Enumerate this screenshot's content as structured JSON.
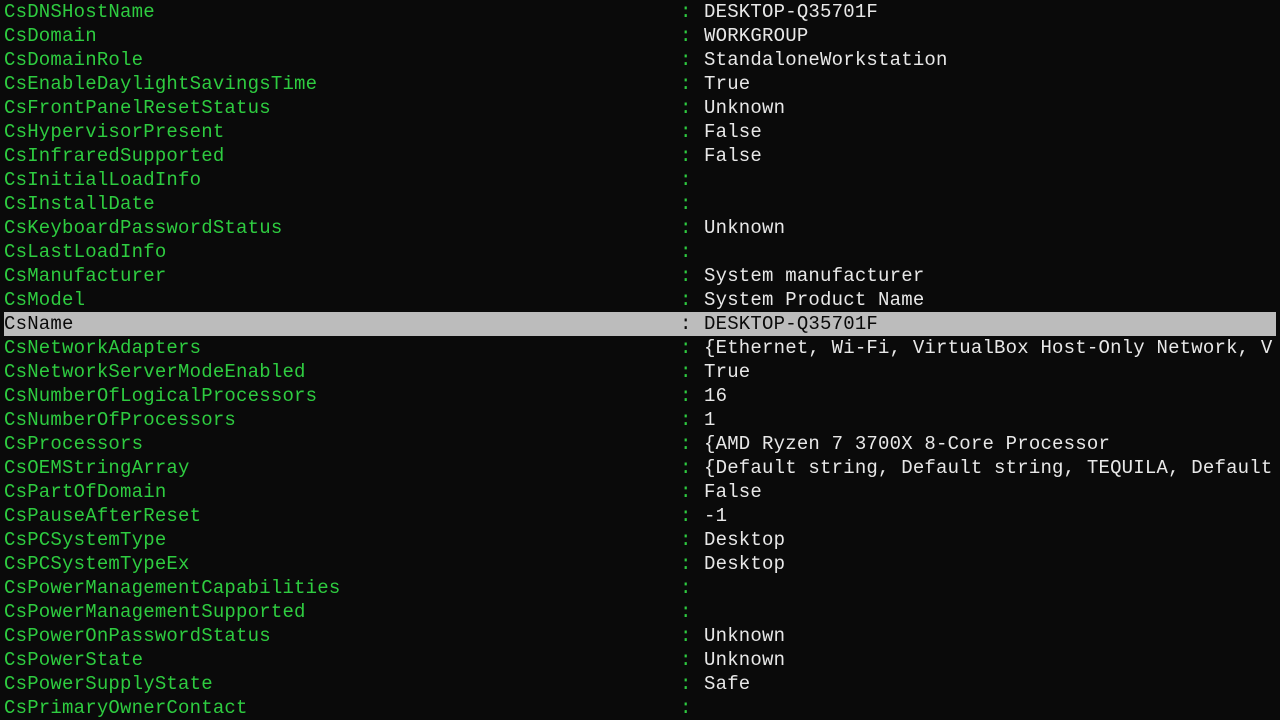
{
  "colors": {
    "bg": "#0a0a0a",
    "prop": "#2ecc40",
    "val": "#e8e8e8",
    "selBg": "#bcbcbc",
    "selFg": "#0a0a0a"
  },
  "selectedIndex": 13,
  "rows": [
    {
      "key": "CsDNSHostName",
      "value": "DESKTOP-Q35701F"
    },
    {
      "key": "CsDomain",
      "value": "WORKGROUP"
    },
    {
      "key": "CsDomainRole",
      "value": "StandaloneWorkstation"
    },
    {
      "key": "CsEnableDaylightSavingsTime",
      "value": "True"
    },
    {
      "key": "CsFrontPanelResetStatus",
      "value": "Unknown"
    },
    {
      "key": "CsHypervisorPresent",
      "value": "False"
    },
    {
      "key": "CsInfraredSupported",
      "value": "False"
    },
    {
      "key": "CsInitialLoadInfo",
      "value": ""
    },
    {
      "key": "CsInstallDate",
      "value": ""
    },
    {
      "key": "CsKeyboardPasswordStatus",
      "value": "Unknown"
    },
    {
      "key": "CsLastLoadInfo",
      "value": ""
    },
    {
      "key": "CsManufacturer",
      "value": "System manufacturer"
    },
    {
      "key": "CsModel",
      "value": "System Product Name"
    },
    {
      "key": "CsName",
      "value": "DESKTOP-Q35701F"
    },
    {
      "key": "CsNetworkAdapters",
      "value": "{Ethernet, Wi-Fi, VirtualBox Host-Only Network, V"
    },
    {
      "key": "CsNetworkServerModeEnabled",
      "value": "True"
    },
    {
      "key": "CsNumberOfLogicalProcessors",
      "value": "16"
    },
    {
      "key": "CsNumberOfProcessors",
      "value": "1"
    },
    {
      "key": "CsProcessors",
      "value": "{AMD Ryzen 7 3700X 8-Core Processor"
    },
    {
      "key": "CsOEMStringArray",
      "value": "{Default string, Default string, TEQUILA, Default"
    },
    {
      "key": "CsPartOfDomain",
      "value": "False"
    },
    {
      "key": "CsPauseAfterReset",
      "value": "-1"
    },
    {
      "key": "CsPCSystemType",
      "value": "Desktop"
    },
    {
      "key": "CsPCSystemTypeEx",
      "value": "Desktop"
    },
    {
      "key": "CsPowerManagementCapabilities",
      "value": ""
    },
    {
      "key": "CsPowerManagementSupported",
      "value": ""
    },
    {
      "key": "CsPowerOnPasswordStatus",
      "value": "Unknown"
    },
    {
      "key": "CsPowerState",
      "value": "Unknown"
    },
    {
      "key": "CsPowerSupplyState",
      "value": "Safe"
    },
    {
      "key": "CsPrimaryOwnerContact",
      "value": ""
    }
  ]
}
